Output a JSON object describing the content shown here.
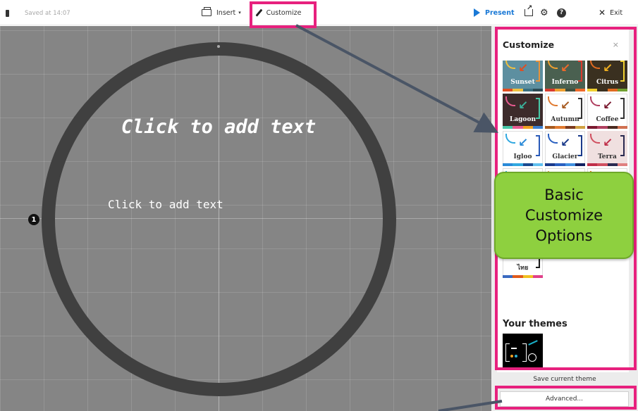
{
  "toolbar": {
    "saved_text": "Saved at 14:07",
    "insert_label": "Insert",
    "insert_caret": "▾",
    "customize_label": "Customize",
    "present_label": "Present",
    "exit_label": "Exit",
    "help_glyph": "?",
    "gear_glyph": "⚙",
    "exit_glyph": "✕"
  },
  "canvas": {
    "title_placeholder": "Click to add text",
    "text_placeholder": "Click to add text",
    "slide_marker": "1"
  },
  "panel": {
    "title": "Customize",
    "close_glyph": "×",
    "themes": [
      {
        "name": "Sunset",
        "bg": "#5d8fa0",
        "text": "#ffffff",
        "arrow": "#e04d20",
        "bracket": "#e8923a",
        "arc": "#f0c040",
        "strip": [
          "#e04d20",
          "#f0c040",
          "#3b6f80",
          "#2c4a55"
        ]
      },
      {
        "name": "Inferno",
        "bg": "#4a6050",
        "text": "#ffffff",
        "arrow": "#f06a2a",
        "bracket": "#d83a2e",
        "arc": "#f0a030",
        "strip": [
          "#d83a2e",
          "#f0a030",
          "#405040",
          "#f06a2a"
        ]
      },
      {
        "name": "Citrus",
        "bg": "#3a3020",
        "text": "#ffffff",
        "arrow": "#f0b020",
        "bracket": "#f0d030",
        "arc": "#e06a20",
        "strip": [
          "#f0d030",
          "#3a3020",
          "#e06a20",
          "#70a030"
        ]
      },
      {
        "name": "Lagoon",
        "bg": "#3d2b2b",
        "text": "#ffffff",
        "arrow": "#3ab09a",
        "bracket": "#48c8a8",
        "arc": "#e85a90",
        "strip": [
          "#48c8a8",
          "#e85a90",
          "#f0a020",
          "#3a7fd0"
        ]
      },
      {
        "name": "Autumn",
        "bg": "#ffffff",
        "text": "#333333",
        "arrow": "#a65a20",
        "bracket": "#333333",
        "arc": "#e07a30",
        "strip": [
          "#a65a20",
          "#e07a30",
          "#7a3a20",
          "#d0a040"
        ]
      },
      {
        "name": "Coffee",
        "bg": "#ffffff",
        "text": "#333333",
        "arrow": "#7a1a30",
        "bracket": "#333333",
        "arc": "#b04060",
        "strip": [
          "#7a1a30",
          "#b04060",
          "#4a2a20",
          "#d07050"
        ]
      },
      {
        "name": "Igloo",
        "bg": "#ffffff",
        "text": "#333333",
        "arrow": "#2a8ad8",
        "bracket": "#2a5ab8",
        "arc": "#30a8e0",
        "strip": [
          "#2a8ad8",
          "#30a8e0",
          "#1a4a90",
          "#60c0f0"
        ]
      },
      {
        "name": "Glacier",
        "bg": "#ffffff",
        "text": "#333333",
        "arrow": "#1a3a8a",
        "bracket": "#1a3a8a",
        "arc": "#2a60c0",
        "strip": [
          "#1a3a8a",
          "#2a60c0",
          "#4090e0",
          "#102060"
        ]
      },
      {
        "name": "Terra",
        "bg": "#f0e0e0",
        "text": "#333333",
        "arrow": "#c0304a",
        "bracket": "#2a2a50",
        "arc": "#d05060",
        "strip": [
          "#c0304a",
          "#d05060",
          "#2a2a50",
          "#e08080"
        ]
      },
      {
        "name": "",
        "bg": "#ffffff",
        "text": "#333333",
        "arrow": "#2a9ad8",
        "bracket": "#1a1a1a",
        "arc": "#30b0e8",
        "strip": [
          "#2a9ad8",
          "#e0a030",
          "#30b0e8",
          "#1a1a1a"
        ]
      },
      {
        "name": "",
        "bg": "#ffffff",
        "text": "#333333",
        "arrow": "#b07a30",
        "bracket": "#1a1a1a",
        "arc": "#e0a060",
        "strip": [
          "#b07a30",
          "#e0a060",
          "#704020",
          "#d0c080"
        ]
      },
      {
        "name": "",
        "bg": "#ffffff",
        "text": "#333333",
        "arrow": "#e03a2a",
        "bracket": "#1a1a1a",
        "arc": "#f07a20",
        "strip": [
          "#e03a2a",
          "#f07a20",
          "#2a2a2a",
          "#f0c020"
        ]
      },
      {
        "name": "",
        "bg": "#ffffff",
        "text": "#333333",
        "arrow": "#c03a3a",
        "bracket": "#2a2a2a",
        "arc": "#e0a040",
        "strip": [
          "#c03a3a",
          "#e0a040",
          "#3a3a8a",
          "#3a9a8a"
        ]
      },
      {
        "name": "",
        "bg": "#ffffff",
        "text": "#333333",
        "arrow": "#2a7a8a",
        "bracket": "#2a2a2a",
        "arc": "#40b0c0",
        "strip": [
          "#2a7a8a",
          "#40b0c0",
          "#2a4a5a",
          "#d0a040"
        ]
      },
      {
        "name": "",
        "bg": "#ffffff",
        "text": "#333333",
        "arrow": "#d03a5a",
        "bracket": "#2a2a2a",
        "arc": "#f0c030",
        "strip": [
          "#d03a5a",
          "#f0c030",
          "#2a5aa0",
          "#e08030"
        ]
      },
      {
        "name": "ไทย",
        "bg": "#ffffff",
        "text": "#333333",
        "arrow": "#e05a1a",
        "bracket": "#1a1a1a",
        "arc": "#bbbbbb",
        "strip": [
          "#3a6ac0",
          "#e05a1a",
          "#f0c020",
          "#e0408a"
        ]
      }
    ],
    "your_themes_title": "Your themes",
    "my_theme_text": "Body",
    "save_theme_label": "Save current theme",
    "advanced_label": "Advanced..."
  },
  "annotation": {
    "callout_line1": "Basic",
    "callout_line2": "Customize",
    "callout_line3": "Options",
    "highlight_color": "#e7217e",
    "callout_color": "#8ed03f"
  }
}
